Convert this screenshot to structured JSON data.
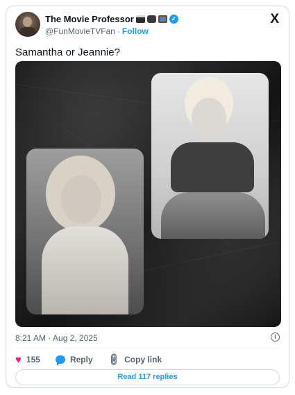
{
  "author": {
    "display_name": "The Movie Professor",
    "emoji_icons": [
      "clapper-board-icon",
      "movie-camera-icon",
      "television-icon"
    ],
    "verified_icon": "verified-badge-icon",
    "handle": "@FunMovieTVFan",
    "separator": "·",
    "follow_label": "Follow"
  },
  "platform_logo": "X",
  "tweet": {
    "text": "Samantha or Jeannie?",
    "timestamp": "8:21 AM · Aug 2, 2025"
  },
  "engagement": {
    "likes": "155",
    "reply_label": "Reply",
    "copy_link_label": "Copy link"
  },
  "read_replies_label": "Read 117 replies",
  "colors": {
    "accent": "#1d9bf0",
    "like": "#f91880",
    "text": "#0f1419",
    "muted": "#536471",
    "border": "#cfd9de"
  }
}
